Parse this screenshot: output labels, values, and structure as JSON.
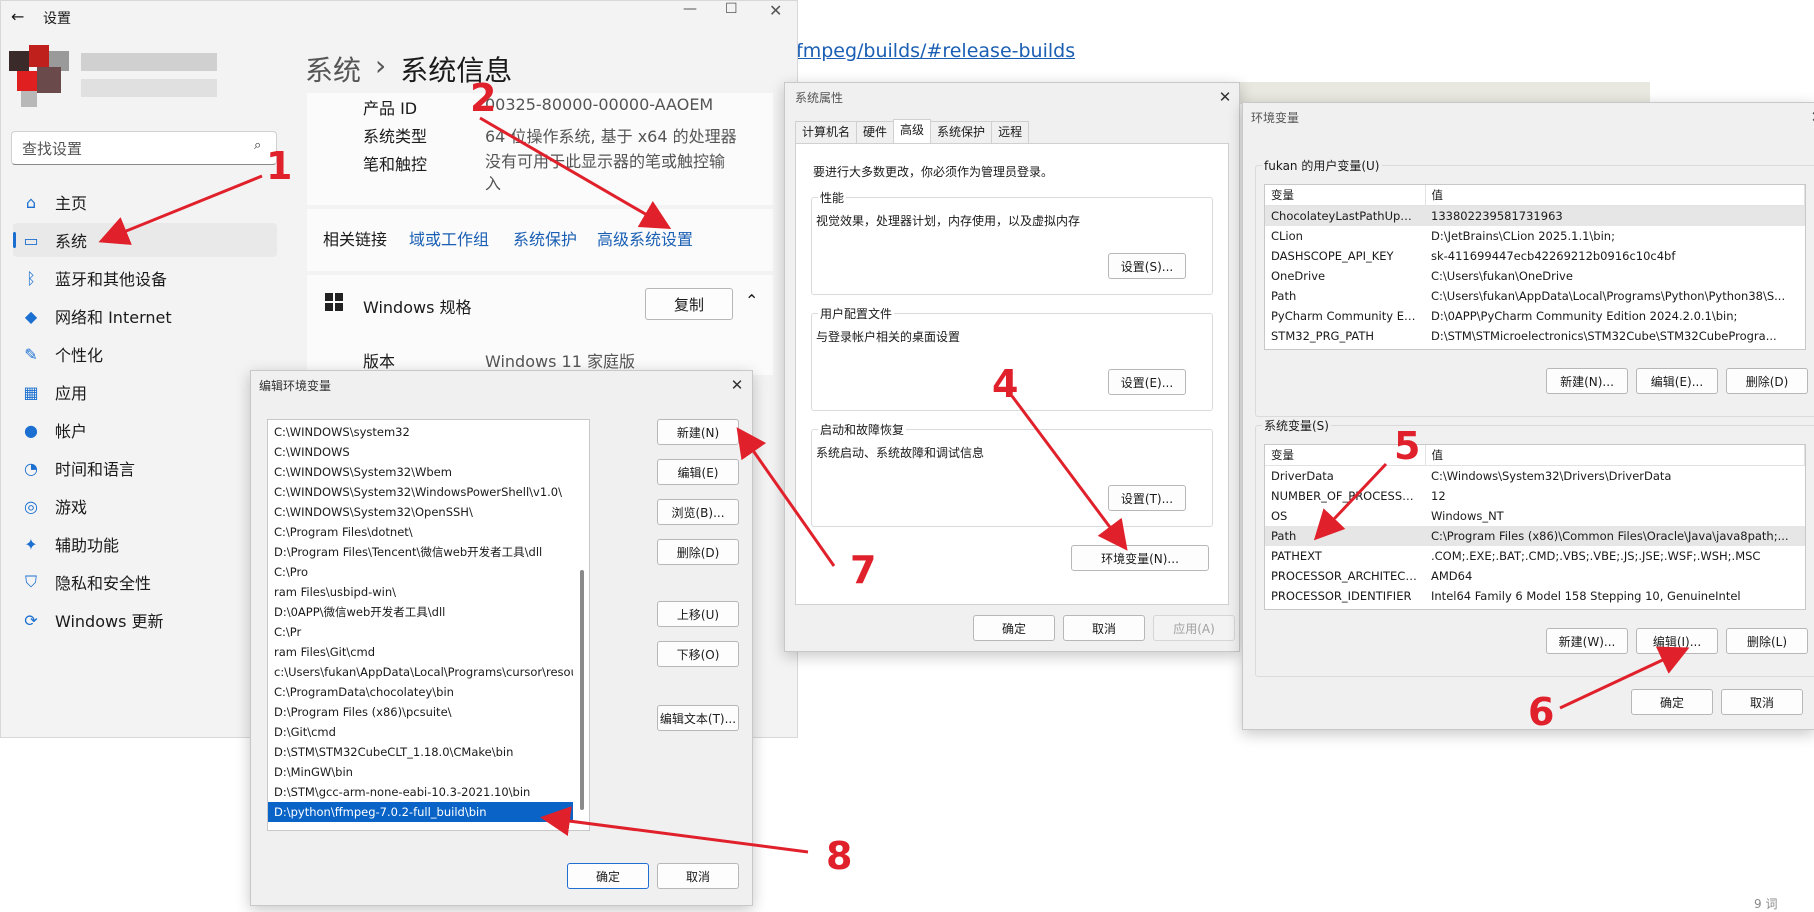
{
  "browser": {
    "url_text": "fmpeg/builds/#release-builds",
    "footer_text": "9 词"
  },
  "settings": {
    "back_icon": "back-arrow-icon",
    "title": "设置",
    "search_placeholder": "查找设置",
    "nav": [
      {
        "label": "主页",
        "icon": "home-icon",
        "glyph": "⌂"
      },
      {
        "label": "系统",
        "icon": "system-icon",
        "glyph": "▭"
      },
      {
        "label": "蓝牙和其他设备",
        "icon": "bluetooth-icon",
        "glyph": "ᛒ"
      },
      {
        "label": "网络和 Internet",
        "icon": "wifi-icon",
        "glyph": "◆"
      },
      {
        "label": "个性化",
        "icon": "brush-icon",
        "glyph": "✎"
      },
      {
        "label": "应用",
        "icon": "apps-icon",
        "glyph": "▦"
      },
      {
        "label": "帐户",
        "icon": "account-icon",
        "glyph": "●"
      },
      {
        "label": "时间和语言",
        "icon": "clock-icon",
        "glyph": "◔"
      },
      {
        "label": "游戏",
        "icon": "gamepad-icon",
        "glyph": "◎"
      },
      {
        "label": "辅助功能",
        "icon": "accessibility-icon",
        "glyph": "✦"
      },
      {
        "label": "隐私和安全性",
        "icon": "shield-icon",
        "glyph": "⛉"
      },
      {
        "label": "Windows 更新",
        "icon": "update-icon",
        "glyph": "⟳"
      }
    ],
    "breadcrumb_parent": "系统",
    "breadcrumb_sep": "›",
    "breadcrumb_current": "系统信息",
    "spec_rows": [
      {
        "label": "产品 ID",
        "value": "00325-80000-00000-AAOEM"
      },
      {
        "label": "系统类型",
        "value": "64 位操作系统, 基于 x64 的处理器"
      },
      {
        "label": "笔和触控",
        "value": "没有可用于此显示器的笔或触控输入"
      }
    ],
    "related_links_label": "相关链接",
    "related_links": [
      "域或工作组",
      "系统保护",
      "高级系统设置"
    ],
    "windows_spec_title": "Windows 规格",
    "copy_button": "复制",
    "version_label": "版本",
    "version_value": "Windows 11 家庭版"
  },
  "sysprops": {
    "title": "系统属性",
    "tabs": [
      "计算机名",
      "硬件",
      "高级",
      "系统保护",
      "远程"
    ],
    "active_tab": 2,
    "admin_note": "要进行大多数更改，你必须作为管理员登录。",
    "perf_title": "性能",
    "perf_desc": "视觉效果，处理器计划，内存使用，以及虚拟内存",
    "perf_btn": "设置(S)...",
    "profile_title": "用户配置文件",
    "profile_desc": "与登录帐户相关的桌面设置",
    "profile_btn": "设置(E)...",
    "startup_title": "启动和故障恢复",
    "startup_desc": "系统启动、系统故障和调试信息",
    "startup_btn": "设置(T)...",
    "env_btn": "环境变量(N)...",
    "ok": "确定",
    "cancel": "取消",
    "apply": "应用(A)"
  },
  "envvars": {
    "title": "环境变量",
    "user_group": "fukan 的用户变量(U)",
    "col_var": "变量",
    "col_val": "值",
    "user_rows": [
      [
        "ChocolateyLastPathUpdate",
        "133802239581731963"
      ],
      [
        "CLion",
        "D:\\JetBrains\\CLion 2025.1.1\\bin;"
      ],
      [
        "DASHSCOPE_API_KEY",
        "sk-411699447ecb42269212b0916c10c4bf"
      ],
      [
        "OneDrive",
        "C:\\Users\\fukan\\OneDrive"
      ],
      [
        "Path",
        "C:\\Users\\fukan\\AppData\\Local\\Programs\\Python\\Python38\\S..."
      ],
      [
        "PyCharm Community Editi...",
        "D:\\0APP\\PyCharm Community Edition 2024.2.0.1\\bin;"
      ],
      [
        "STM32_PRG_PATH",
        "D:\\STM\\STMicroelectronics\\STM32Cube\\STM32CubeProgra..."
      ]
    ],
    "user_new": "新建(N)...",
    "user_edit": "编辑(E)...",
    "user_delete": "删除(D)",
    "sys_group": "系统变量(S)",
    "sys_rows": [
      [
        "DriverData",
        "C:\\Windows\\System32\\Drivers\\DriverData"
      ],
      [
        "NUMBER_OF_PROCESSORS",
        "12"
      ],
      [
        "OS",
        "Windows_NT"
      ],
      [
        "Path",
        "C:\\Program Files (x86)\\Common Files\\Oracle\\Java\\java8path;..."
      ],
      [
        "PATHEXT",
        ".COM;.EXE;.BAT;.CMD;.VBS;.VBE;.JS;.JSE;.WSF;.WSH;.MSC"
      ],
      [
        "PROCESSOR_ARCHITECT...",
        "AMD64"
      ],
      [
        "PROCESSOR_IDENTIFIER",
        "Intel64 Family 6 Model 158 Stepping 10, GenuineIntel"
      ]
    ],
    "sys_new": "新建(W)...",
    "sys_edit": "编辑(I)...",
    "sys_delete": "删除(L)",
    "ok": "确定",
    "cancel": "取消"
  },
  "editenv": {
    "title": "编辑环境变量",
    "paths": [
      "C:\\WINDOWS\\system32",
      "C:\\WINDOWS",
      "C:\\WINDOWS\\System32\\Wbem",
      "C:\\WINDOWS\\System32\\WindowsPowerShell\\v1.0\\",
      "C:\\WINDOWS\\System32\\OpenSSH\\",
      "C:\\Program Files\\dotnet\\",
      "D:\\Program Files\\Tencent\\微信web开发者工具\\dll",
      "C:\\Pro",
      "ram Files\\usbipd-win\\",
      "D:\\0APP\\微信web开发者工具\\dll",
      "C:\\Pr",
      "ram Files\\Git\\cmd",
      "c:\\Users\\fukan\\AppData\\Local\\Programs\\cursor\\resources\\a...",
      "C:\\ProgramData\\chocolatey\\bin",
      "D:\\Program Files (x86)\\pcsuite\\",
      "D:\\Git\\cmd",
      "D:\\STM\\STM32CubeCLT_1.18.0\\CMake\\bin",
      "D:\\MinGW\\bin",
      "D:\\STM\\gcc-arm-none-eabi-10.3-2021.10\\bin",
      "D:\\python\\ffmpeg-7.0.2-full_build\\bin"
    ],
    "selected_index": 19,
    "btn_new": "新建(N)",
    "btn_edit": "编辑(E)",
    "btn_browse": "浏览(B)...",
    "btn_delete": "删除(D)",
    "btn_up": "上移(U)",
    "btn_down": "下移(O)",
    "btn_edit_text": "编辑文本(T)...",
    "ok": "确定",
    "cancel": "取消"
  },
  "annotations": [
    "1",
    "2",
    "4",
    "5",
    "6",
    "7",
    "8"
  ],
  "colors": {
    "accent_link": "#1a5fb4",
    "annotation_red": "#e0212b",
    "selection_blue": "#0a64c8"
  }
}
